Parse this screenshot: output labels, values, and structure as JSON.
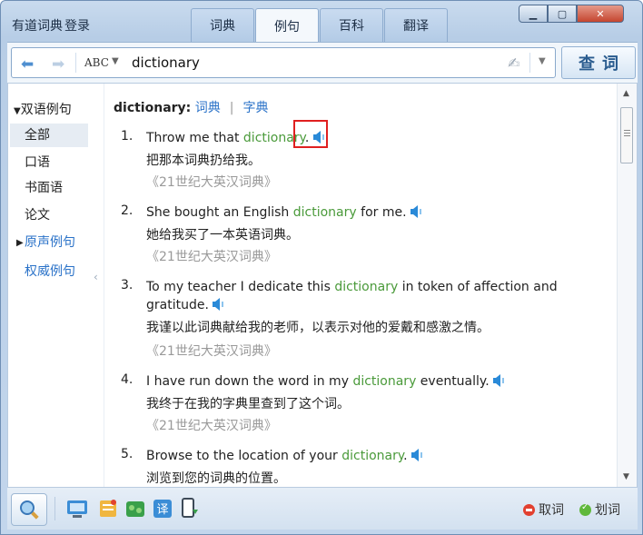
{
  "app": {
    "title": "有道词典",
    "login": "登录"
  },
  "tabs": [
    {
      "label": "词典"
    },
    {
      "label": "例句"
    },
    {
      "label": "百科"
    },
    {
      "label": "翻译"
    }
  ],
  "window_controls": {
    "minimize": "▁",
    "maximize": "▢",
    "close": "✕"
  },
  "toolbar": {
    "input_mode": "ABC",
    "query": "dictionary",
    "search_label": "查词"
  },
  "sidebar": {
    "heading": "双语例句",
    "items": [
      {
        "label": "全部"
      },
      {
        "label": "口语"
      },
      {
        "label": "书面语"
      },
      {
        "label": "论文"
      }
    ],
    "audio_examples": "原声例句",
    "authority_examples": "权威例句"
  },
  "main": {
    "word": "dictionary:",
    "link1": "词典",
    "divider": "|",
    "link2": "字典",
    "examples": [
      {
        "num": "1.",
        "before": "Throw me that ",
        "hl": "dictionary",
        "after": ".",
        "zh": "把那本词典扔给我。",
        "src": "《21世纪大英汉词典》"
      },
      {
        "num": "2.",
        "before": "She bought an English ",
        "hl": "dictionary",
        "after": " for me.",
        "zh": "她给我买了一本英语词典。",
        "src": "《21世纪大英汉词典》"
      },
      {
        "num": "3.",
        "before": "To my teacher I dedicate this ",
        "hl": "dictionary",
        "after": " in token of affection and gratitude.",
        "zh": "我谨以此词典献给我的老师，以表示对他的爱戴和感激之情。",
        "src": "《21世纪大英汉词典》"
      },
      {
        "num": "4.",
        "before": "I have run down the word in my ",
        "hl": "dictionary",
        "after": " eventually.",
        "zh": "我终于在我的字典里查到了这个词。",
        "src": "《21世纪大英汉词典》"
      },
      {
        "num": "5.",
        "before": "Browse to the location of your ",
        "hl": "dictionary",
        "after": ".",
        "zh": "浏览到您的词典的位置。",
        "src": ""
      }
    ]
  },
  "bottom": {
    "cancel_label": "取词",
    "select_label": "划词"
  },
  "colors": {
    "accent": "#2a72c8",
    "highlight": "#4a9a3a",
    "source": "#999999",
    "annotation": "#e02020"
  }
}
